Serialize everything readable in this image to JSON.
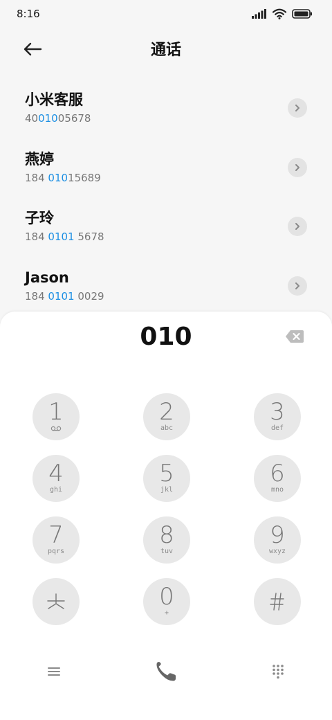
{
  "status_bar": {
    "time": "8:16"
  },
  "header": {
    "title": "通话"
  },
  "contacts": [
    {
      "name": "小米客服",
      "number_pre": "40",
      "number_match": "010",
      "number_post": "05678"
    },
    {
      "name": "燕婷",
      "number_pre": "184 ",
      "number_match": "010",
      "number_post": "15689"
    },
    {
      "name": "子玲",
      "number_pre": "184 ",
      "number_match": "0101",
      "number_post": " 5678"
    },
    {
      "name": "Jason",
      "number_pre": "184 ",
      "number_match": "0101",
      "number_post": " 0029"
    }
  ],
  "dialer": {
    "input": "010",
    "keys": [
      {
        "digit": "1",
        "letters": ""
      },
      {
        "digit": "2",
        "letters": "abc"
      },
      {
        "digit": "3",
        "letters": "def"
      },
      {
        "digit": "4",
        "letters": "ghi"
      },
      {
        "digit": "5",
        "letters": "jkl"
      },
      {
        "digit": "6",
        "letters": "mno"
      },
      {
        "digit": "7",
        "letters": "pqrs"
      },
      {
        "digit": "8",
        "letters": "tuv"
      },
      {
        "digit": "9",
        "letters": "wxyz"
      },
      {
        "digit": "*",
        "letters": ""
      },
      {
        "digit": "0",
        "letters": "+"
      },
      {
        "digit": "#",
        "letters": ""
      }
    ]
  },
  "icons": {
    "back": "arrow-left-icon",
    "backspace": "backspace-icon",
    "menu": "menu-icon",
    "call": "phone-icon",
    "keypad": "keypad-icon",
    "voicemail": "voicemail-icon"
  },
  "colors": {
    "highlight": "#1c8fe3",
    "key_bg": "#e8e8e8",
    "call": "#666666"
  }
}
